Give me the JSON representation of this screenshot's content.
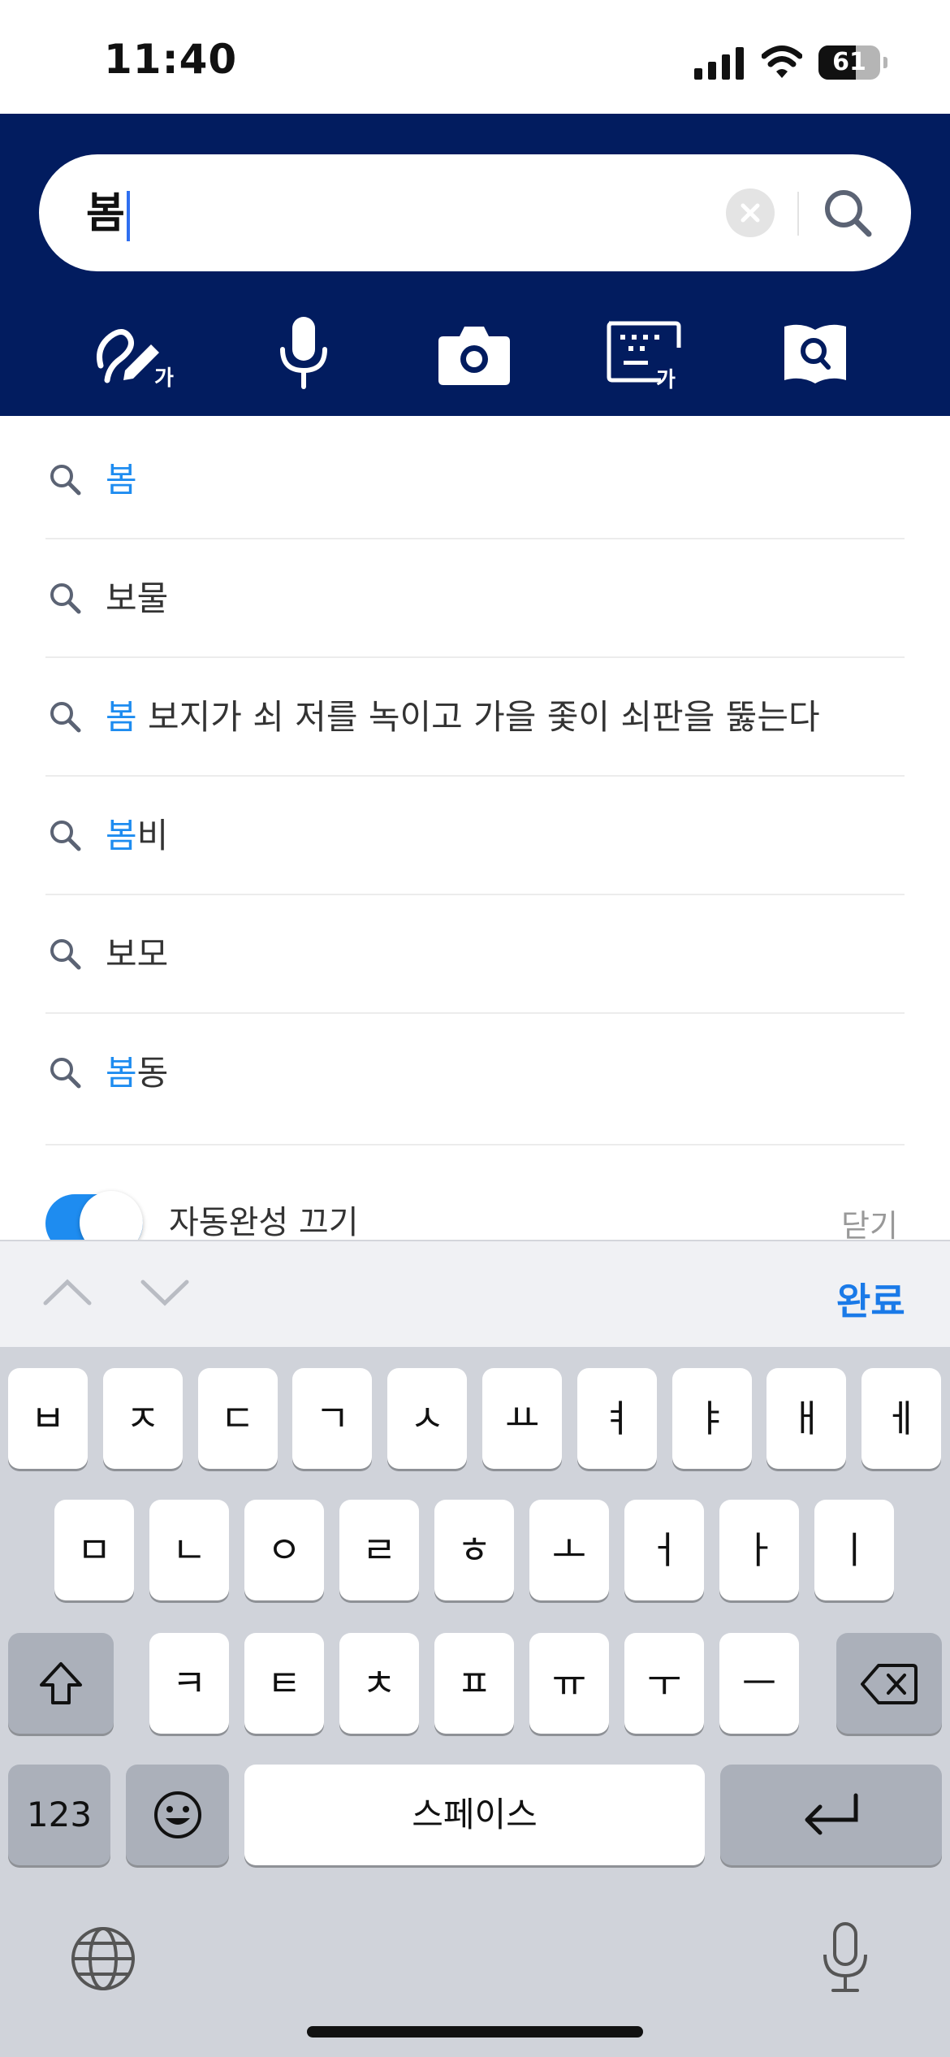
{
  "status_bar": {
    "time": "11:40",
    "battery": "61",
    "battery_level": 0.61
  },
  "search": {
    "query": "봄"
  },
  "suggestions": [
    {
      "highlight": "봄",
      "rest": ""
    },
    {
      "highlight": "",
      "rest": "보물"
    },
    {
      "highlight": "봄",
      "rest": " 보지가 쇠 저를 녹이고 가을 좇이 쇠판을 뚫는다"
    },
    {
      "highlight": "봄",
      "rest": "비"
    },
    {
      "highlight": "",
      "rest": "보모"
    },
    {
      "highlight": "봄",
      "rest": "동"
    }
  ],
  "autocomplete": {
    "toggle_label": "자동완성 끄기",
    "toggle_on": true,
    "close_label": "닫기"
  },
  "toolbar_icons": [
    "handwriting-icon",
    "microphone-icon",
    "camera-icon",
    "keyboard-icon",
    "book-search-icon"
  ],
  "accessory": {
    "done_label": "완료"
  },
  "keyboard": {
    "row1": [
      "ㅂ",
      "ㅈ",
      "ㄷ",
      "ㄱ",
      "ㅅ",
      "ㅛ",
      "ㅕ",
      "ㅑ",
      "ㅐ",
      "ㅔ"
    ],
    "row2": [
      "ㅁ",
      "ㄴ",
      "ㅇ",
      "ㄹ",
      "ㅎ",
      "ㅗ",
      "ㅓ",
      "ㅏ",
      "ㅣ"
    ],
    "row3": [
      "ㅋ",
      "ㅌ",
      "ㅊ",
      "ㅍ",
      "ㅠ",
      "ㅜ",
      "ㅡ"
    ],
    "numbers_label": "123",
    "space_label": "스페이스"
  },
  "colors": {
    "header": "#021c5f",
    "accent": "#1e8cf0"
  }
}
